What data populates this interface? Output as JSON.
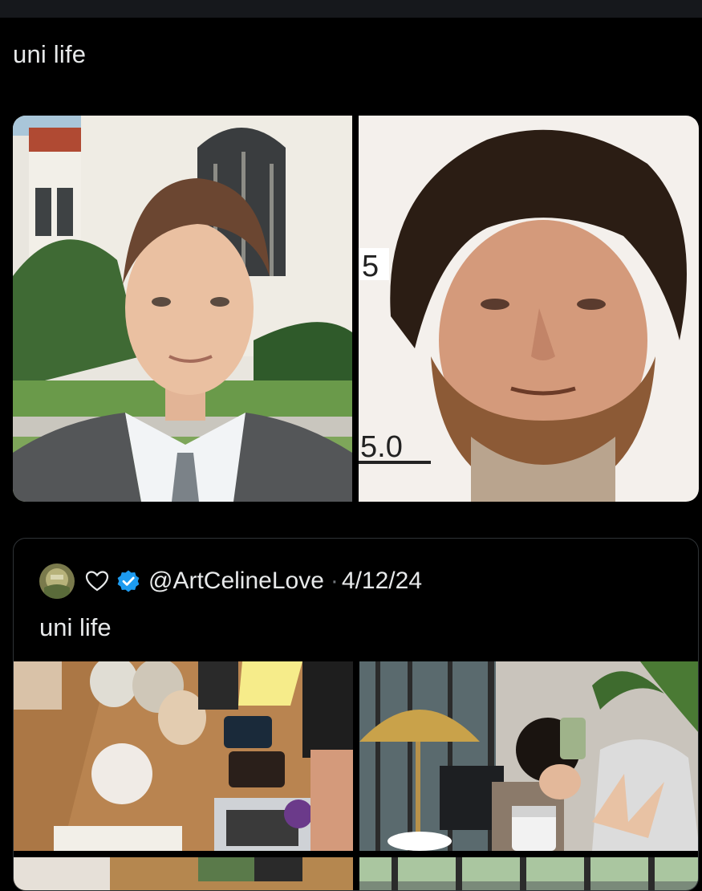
{
  "post": {
    "text": "uni life"
  },
  "quoted": {
    "heart": "♡",
    "handle": "@ArtCelineLove",
    "separator": "·",
    "date": "4/12/24",
    "text": "uni life"
  },
  "icons": {
    "heart": "heart-icon",
    "verified": "verified-badge-icon"
  },
  "colors": {
    "background": "#000000",
    "text": "#e7e9ea",
    "verified": "#1d9bf0",
    "border": "#2f3336"
  }
}
